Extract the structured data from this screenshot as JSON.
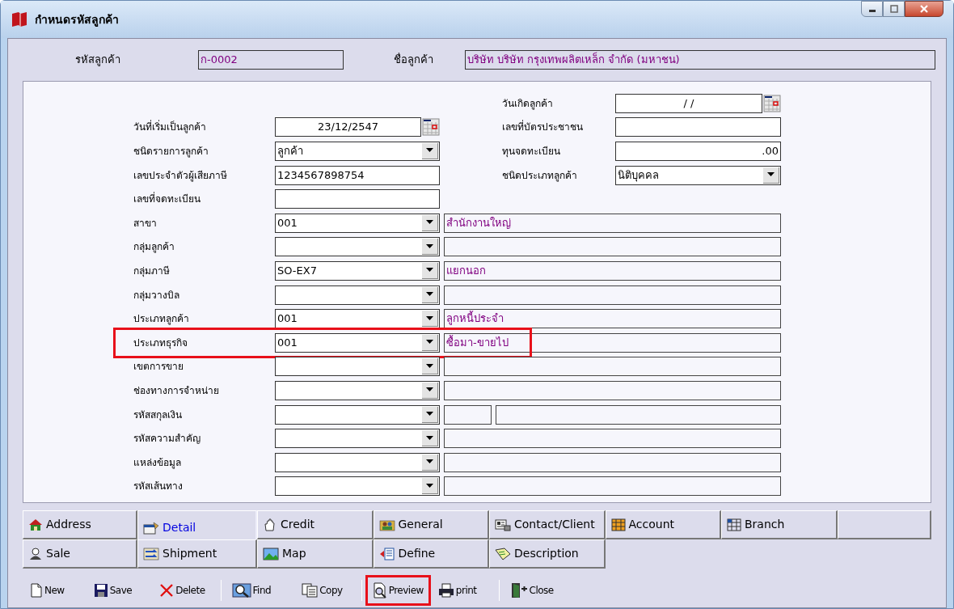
{
  "window": {
    "title": "กำหนดรหัสลูกค้า"
  },
  "header": {
    "code_label": "รหัสลูกค้า",
    "code_value": "ก-0002",
    "name_label": "ชื่อลูกค้า",
    "name_value": "บริษัท บริษัท กรุงเทพผลิตเหล็ก จำกัด (มหาชน)"
  },
  "right_fields": [
    {
      "label": "วันเกิดลูกค้า",
      "kind": "date",
      "value": "/ /"
    },
    {
      "label": "เลขที่บัตรประชาชน",
      "kind": "text"
    },
    {
      "label": "ทุนจดทะเบียน",
      "kind": "number",
      "value": ".00"
    },
    {
      "label": "ชนิดประเภทลูกค้า",
      "kind": "combo",
      "value": "นิติบุคคล"
    }
  ],
  "left_fields": [
    {
      "label": "วันที่เริ่มเป็นลูกค้า",
      "kind": "date",
      "value": "23/12/2547"
    },
    {
      "label": "ชนิดรายการลูกค้า",
      "kind": "combo",
      "value": "ลูกค้า"
    },
    {
      "label": "เลขประจำตัวผู้เสียภาษี",
      "kind": "text",
      "value": "1234567898754"
    },
    {
      "label": "เลขที่จดทะเบียน",
      "kind": "text"
    },
    {
      "label": "สาขา",
      "kind": "lookup",
      "value": "001",
      "description": "สำนักงานใหญ่"
    },
    {
      "label": "กลุ่มลูกค้า",
      "kind": "lookup"
    },
    {
      "label": "กลุ่มภาษี",
      "kind": "lookup",
      "value": "SO-EX7",
      "description": "แยกนอก"
    },
    {
      "label": "กลุ่มวางบิล",
      "kind": "lookup"
    },
    {
      "label": "ประเภทลูกค้า",
      "kind": "lookup",
      "value": "001",
      "description": "ลูกหนี้ประจำ"
    },
    {
      "label": "ประเภทธุรกิจ",
      "kind": "lookup",
      "value": "001",
      "description": "ซื้อมา-ขายไป",
      "highlighted": true
    },
    {
      "label": "เขตการขาย",
      "kind": "lookup"
    },
    {
      "label": "ช่องทางการจำหน่าย",
      "kind": "lookup"
    },
    {
      "label": "รหัสสกุลเงิน",
      "kind": "lookup_split"
    },
    {
      "label": "รหัสความสำคัญ",
      "kind": "lookup"
    },
    {
      "label": "แหล่งข้อมูล",
      "kind": "lookup"
    },
    {
      "label": "รหัสเส้นทาง",
      "kind": "lookup"
    }
  ],
  "tabs": [
    [
      {
        "label": "Address",
        "selected": false
      },
      {
        "label": "Detail",
        "selected": true
      },
      {
        "label": "Credit",
        "selected": false
      },
      {
        "label": "General",
        "selected": false
      },
      {
        "label": "Contact/Client",
        "selected": false
      },
      {
        "label": "Account",
        "selected": false
      },
      {
        "label": "Branch",
        "selected": false
      }
    ],
    [
      {
        "label": "Sale",
        "selected": false
      },
      {
        "label": "Shipment",
        "selected": false
      },
      {
        "label": "Map",
        "selected": false
      },
      {
        "label": "Define",
        "selected": false
      },
      {
        "label": "Description",
        "selected": false
      }
    ]
  ],
  "toolbar": [
    {
      "label": "New",
      "highlighted": false
    },
    {
      "label": "Save",
      "highlighted": false
    },
    {
      "label": "Delete",
      "highlighted": false
    },
    {
      "label": "Find",
      "highlighted": false
    },
    {
      "label": "Copy",
      "highlighted": false
    },
    {
      "label": "Preview",
      "highlighted": true
    },
    {
      "label": "print",
      "highlighted": false
    },
    {
      "label": "Close",
      "highlighted": false
    }
  ]
}
